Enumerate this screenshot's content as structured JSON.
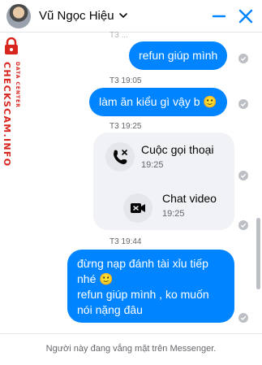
{
  "header": {
    "contact_name": "Vũ Ngọc Hiệu"
  },
  "watermark": {
    "main": "CHECKSCAM.INFO",
    "sub": "DATA CENTER"
  },
  "colors": {
    "accent": "#0084ff",
    "watermark": "#d8261f",
    "incoming_bg": "#f0f2f5"
  },
  "messages": [
    {
      "timestamp": "T3 ...",
      "text": "refun giúp mình",
      "direction": "outgoing"
    },
    {
      "timestamp": "T3 19:05",
      "text": "làm ăn kiểu gì vậy b 🙂",
      "direction": "outgoing"
    },
    {
      "timestamp": "T3 19:25",
      "direction": "incoming",
      "calls": [
        {
          "title": "Cuộc gọi thoại",
          "time": "19:25",
          "icon": "phone-missed-icon"
        },
        {
          "title": "Chat video",
          "time": "19:25",
          "icon": "video-camera-icon"
        }
      ]
    },
    {
      "timestamp": "T3 19:44",
      "direction": "outgoing",
      "lines": [
        "đừng nạp đánh tài xỉu tiếp",
        "nhé 🙂",
        "refun giúp mình , ko muốn",
        "nói nặng đâu"
      ]
    }
  ],
  "footer": {
    "status": "Người này đang vắng mặt trên Messenger."
  }
}
